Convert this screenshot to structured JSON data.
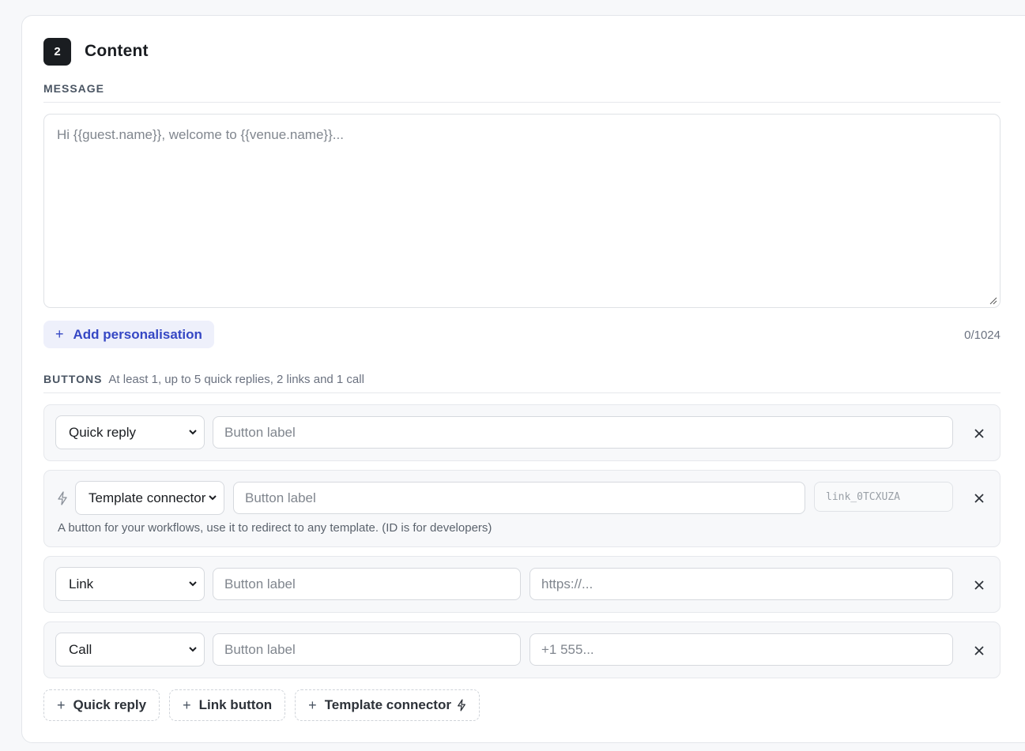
{
  "section": {
    "step": "2",
    "title": "Content"
  },
  "message": {
    "label": "MESSAGE",
    "placeholder": "Hi {{guest.name}}, welcome to {{venue.name}}...",
    "value": "",
    "counter": "0/1024",
    "add_personalisation": "Add personalisation"
  },
  "buttons": {
    "label": "BUTTONS",
    "hint": "At least 1, up to 5 quick replies, 2 links and 1 call",
    "rows": [
      {
        "type": "Quick reply",
        "label_placeholder": "Button label"
      },
      {
        "type": "Template connector",
        "label_placeholder": "Button label",
        "id": "link_0TCXUZA",
        "description": "A button for your workflows, use it to redirect to any template. (ID is for developers)"
      },
      {
        "type": "Link",
        "label_placeholder": "Button label",
        "value_placeholder": "https://..."
      },
      {
        "type": "Call",
        "label_placeholder": "Button label",
        "value_placeholder": "+1 555..."
      }
    ],
    "add": {
      "quick_reply": "Quick reply",
      "link_button": "Link button",
      "template_connector": "Template connector"
    }
  },
  "icons": {
    "close": "close-icon",
    "chevron": "chevron-down-icon",
    "bolt": "lightning-bolt-icon",
    "plus": "plus-icon"
  },
  "colors": {
    "accent": "#3547c4",
    "accent_bg": "#eef0fb",
    "badge": "#1a1d21"
  }
}
